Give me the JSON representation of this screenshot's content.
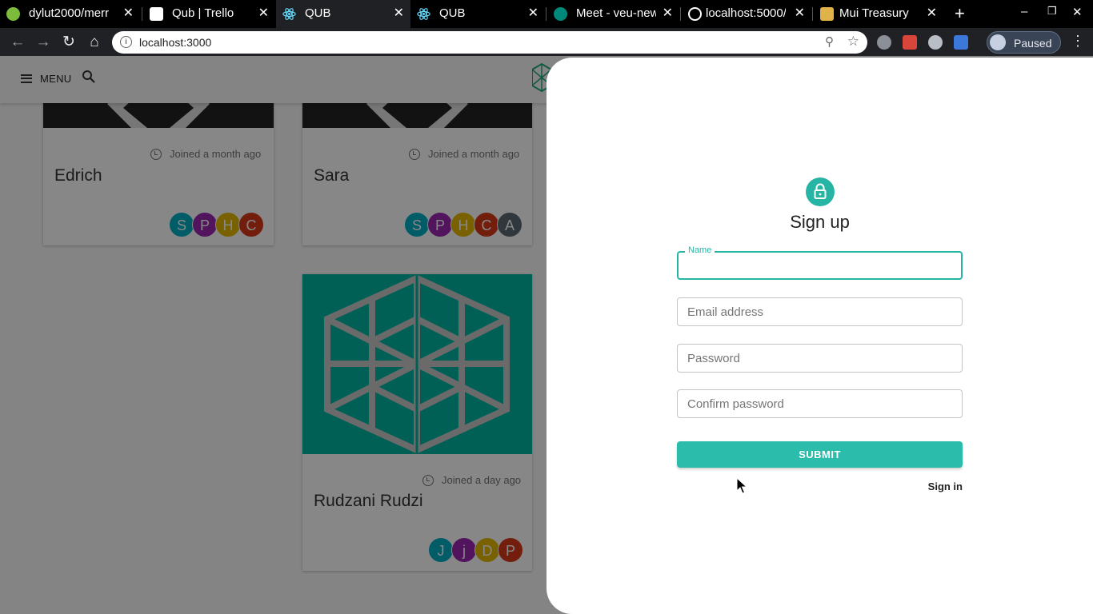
{
  "browser": {
    "tabs": [
      {
        "title": "dylut2000/merr",
        "favicon": "github-icon",
        "color": "#7dbb3c"
      },
      {
        "title": "Qub | Trello",
        "favicon": "trello-icon",
        "color": "#ffffff"
      },
      {
        "title": "QUB",
        "favicon": "react-icon",
        "color": "#61dafb",
        "active": true
      },
      {
        "title": "QUB",
        "favicon": "react-icon",
        "color": "#61dafb"
      },
      {
        "title": "Meet - veu-new",
        "favicon": "meet-icon",
        "color": "#00897b"
      },
      {
        "title": "localhost:5000/",
        "favicon": "globe-icon",
        "color": "#ffffff"
      },
      {
        "title": "Mui Treasury",
        "favicon": "mui-treasury-icon",
        "color": "#e0b24a"
      }
    ],
    "url": "localhost:3000",
    "profile_status": "Paused"
  },
  "appbar": {
    "menu_label": "MENU"
  },
  "cards": [
    {
      "name": "Edrich",
      "joined": "Joined a month ago",
      "avatars": [
        "S",
        "P",
        "H",
        "C"
      ]
    },
    {
      "name": "Sara",
      "joined": "Joined a month ago",
      "avatars": [
        "S",
        "P",
        "H",
        "C",
        "A"
      ]
    },
    {
      "name": "Rudzani Rudzi",
      "joined": "Joined a day ago",
      "avatars": [
        "J",
        "j",
        "D",
        "P"
      ]
    }
  ],
  "signup": {
    "heading": "Sign up",
    "name_label": "Name",
    "name_value": "",
    "email_placeholder": "Email address",
    "password_placeholder": "Password",
    "confirm_placeholder": "Confirm password",
    "submit_label": "SUBMIT",
    "signin_label": "Sign in"
  },
  "colors": {
    "accent": "#26b5a5",
    "hero_teal": "#00b5a3",
    "hero_dark": "#222222",
    "avatar_palette": [
      "#00aec3",
      "#9c27b0",
      "#e6b800",
      "#d93a1a",
      "#5c6b73"
    ]
  }
}
